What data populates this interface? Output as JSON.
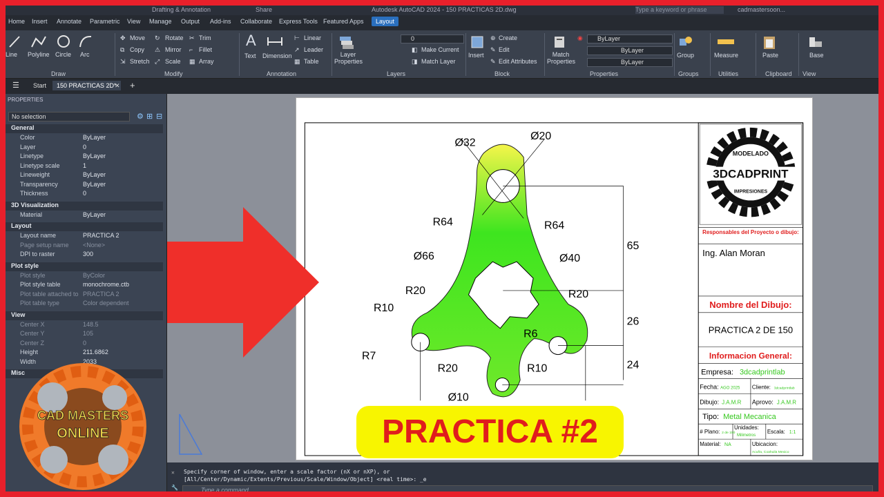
{
  "titlebar": {
    "workspace": "Drafting & Annotation",
    "share": "Share",
    "app_title": "Autodesk AutoCAD 2024 - 150 PRACTICAS 2D.dwg",
    "search_placeholder": "Type a keyword or phrase",
    "user": "cadmastersoon..."
  },
  "ribbon_tabs": [
    "Home",
    "Insert",
    "Annotate",
    "Parametric",
    "View",
    "Manage",
    "Output",
    "Add-ins",
    "Collaborate",
    "Express Tools",
    "Featured Apps",
    "Layout"
  ],
  "active_tab": "Layout",
  "draw": {
    "line": "Line",
    "polyline": "Polyline",
    "circle": "Circle",
    "arc": "Arc",
    "panel": "Draw"
  },
  "modify": {
    "move": "Move",
    "rotate": "Rotate",
    "trim": "Trim",
    "copy": "Copy",
    "mirror": "Mirror",
    "fillet": "Fillet",
    "stretch": "Stretch",
    "scale": "Scale",
    "array": "Array",
    "panel": "Modify"
  },
  "annotation": {
    "text": "Text",
    "dimension": "Dimension",
    "linear": "Linear",
    "leader": "Leader",
    "table": "Table",
    "panel": "Annotation"
  },
  "layers": {
    "layer_properties": "Layer Properties",
    "current_layer": "0",
    "make_current": "Make Current",
    "match_layer": "Match Layer",
    "panel": "Layers"
  },
  "block": {
    "insert": "Insert",
    "create": "Create",
    "edit": "Edit",
    "edit_attributes": "Edit Attributes",
    "panel": "Block"
  },
  "properties_panel": {
    "match": "Match Properties",
    "bylayer": "ByLayer",
    "panel": "Properties"
  },
  "groups": {
    "group": "Group",
    "panel": "Groups"
  },
  "utilities": {
    "measure": "Measure",
    "panel": "Utilities"
  },
  "clipboard": {
    "paste": "Paste",
    "panel": "Clipboard"
  },
  "view_panel": {
    "base": "Base",
    "panel": "View"
  },
  "doc_tabs": {
    "start": "Start",
    "active": "150 PRACTICAS 2D*"
  },
  "properties": {
    "title": "PROPERTIES",
    "selection": "No selection",
    "sections": [
      {
        "name": "General",
        "rows": [
          [
            "Color",
            "ByLayer"
          ],
          [
            "Layer",
            "0"
          ],
          [
            "Linetype",
            "ByLayer"
          ],
          [
            "Linetype scale",
            "1"
          ],
          [
            "Lineweight",
            "ByLayer"
          ],
          [
            "Transparency",
            "ByLayer"
          ],
          [
            "Thickness",
            "0"
          ]
        ]
      },
      {
        "name": "3D Visualization",
        "rows": [
          [
            "Material",
            "ByLayer"
          ]
        ]
      },
      {
        "name": "Layout",
        "rows": [
          [
            "Layout name",
            "PRACTICA 2"
          ],
          [
            "Page setup name",
            "<None>"
          ],
          [
            "DPI to raster",
            "300"
          ]
        ]
      },
      {
        "name": "Plot style",
        "rows": [
          [
            "Plot style",
            "ByColor"
          ],
          [
            "Plot style table",
            "monochrome.ctb"
          ],
          [
            "Plot table attached to",
            "PRACTICA 2"
          ],
          [
            "Plot table type",
            "Color dependent"
          ]
        ]
      },
      {
        "name": "View",
        "rows": [
          [
            "Center X",
            "148.5"
          ],
          [
            "Center Y",
            "105"
          ],
          [
            "Center Z",
            "0"
          ],
          [
            "Height",
            "211.6862"
          ],
          [
            "Width",
            "2033"
          ]
        ]
      },
      {
        "name": "Misc",
        "rows": []
      }
    ]
  },
  "drawing": {
    "dims": [
      "Ø32",
      "Ø20",
      "R64",
      "R64",
      "Ø66",
      "Ø40",
      "R20",
      "R20",
      "R10",
      "R6",
      "R7",
      "R20",
      "R10",
      "Ø10",
      "65",
      "26",
      "24"
    ],
    "title_block": {
      "logo_top": "MODELADO",
      "logo_main": "3DCADPRINT",
      "logo_bottom": "IMPRESIONES",
      "responsables_label": "Responsables del Proyecto o dibujo:",
      "responsable": "Ing. Alan Moran",
      "nombre_label": "Nombre del Dibujo:",
      "nombre": "PRACTICA 2 DE 150",
      "info_label": "Informacion General:",
      "empresa_label": "Empresa:",
      "empresa": "3dcadprintlab",
      "fecha_label": "Fecha:",
      "fecha": "AGO 2025",
      "cliente_label": "Cliente:",
      "cliente": "3dcadprintlab",
      "dibujo_label": "Dibujo:",
      "dibujo": "J.A.M.R",
      "aprovo_label": "Aprovo:",
      "aprovo": "J.A.M.R",
      "tipo_label": "Tipo:",
      "tipo": "Metal Mecanica",
      "plano_label": "# Plano:",
      "plano": "2 de 150",
      "unidades_label": "Unidades:",
      "unidades": "Milimetros",
      "escala_label": "Escala:",
      "escala": "1:1",
      "material_label": "Material:",
      "material": "NA",
      "ubicacion_label": "Ubicacion:",
      "ubicacion": "Acuña, Coahuila Mexico"
    }
  },
  "command": {
    "line1": "Specify corner of window, enter a scale factor (nX or nXP), or",
    "line2": "[All/Center/Dynamic/Extents/Previous/Scale/Window/Object] <real time>: _e",
    "placeholder": "Type a command"
  },
  "overlay": {
    "title": "PRACTICA #2",
    "logo_line1": "CAD MASTERS",
    "logo_line2": "ONLINE"
  },
  "colors": {
    "accent": "#2a6fbe",
    "frame": "#e8202b",
    "part_fill": "#3ee51f",
    "highlight": "#f8f500",
    "red_text": "#e01d1d",
    "green_text": "#35c81e"
  }
}
